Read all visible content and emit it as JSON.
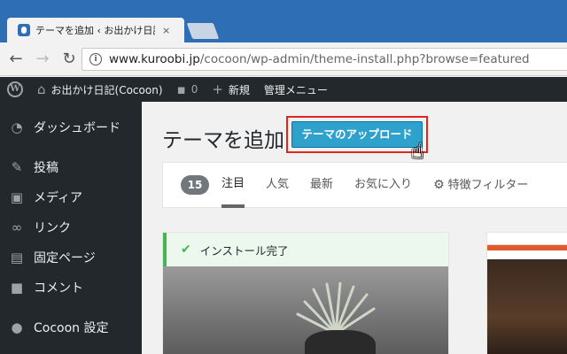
{
  "browser": {
    "tab_title": "テーマを追加 ‹ お出かけ日記",
    "tab_close": "×",
    "url_host": "www.kuroobi.jp",
    "url_path": "/cocoon/wp-admin/theme-install.php?browse=featured"
  },
  "adminbar": {
    "site_name": "お出かけ日記(Cocoon)",
    "comments_count": "0",
    "new_label": "新規",
    "admin_menu_label": "管理メニュー"
  },
  "sidebar": {
    "items": [
      {
        "label": "ダッシュボード",
        "icon": "dashboard-icon"
      },
      {
        "label": "投稿",
        "icon": "pin-icon"
      },
      {
        "label": "メディア",
        "icon": "media-icon"
      },
      {
        "label": "リンク",
        "icon": "link-icon"
      },
      {
        "label": "固定ページ",
        "icon": "page-icon"
      },
      {
        "label": "コメント",
        "icon": "comment-icon"
      },
      {
        "label": "Cocoon 設定",
        "icon": "cocoon-icon"
      }
    ]
  },
  "main": {
    "page_title": "テーマを追加",
    "upload_button": "テーマのアップロード",
    "theme_count": "15",
    "filters": [
      "注目",
      "人気",
      "最新",
      "お気に入り"
    ],
    "feature_filter": "特徴フィルター",
    "install_notice": "インストール完了"
  }
}
